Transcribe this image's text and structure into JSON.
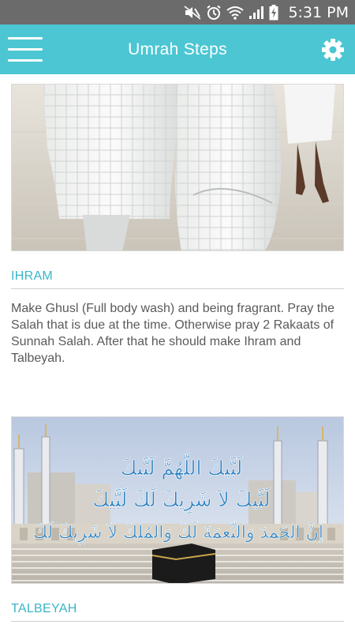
{
  "status_bar": {
    "time": "5:31 PM",
    "icons": [
      "mute-icon",
      "alarm-icon",
      "wifi-icon",
      "signal-icon",
      "battery-charging-icon"
    ]
  },
  "app_bar": {
    "title": "Umrah Steps",
    "menu_icon": "hamburger-menu-icon",
    "settings_icon": "gear-icon",
    "background_color": "#4cc6d3"
  },
  "steps": [
    {
      "title": "IHRAM",
      "description": "Make Ghusl (Full body wash) and being fragrant. Pray the Salah that is due at the time. Otherwise pray 2 Rakaats of Sunnah Salah. After that he should make Ihram and Talbeyah.",
      "image": "pilgrims-in-ihram-photo"
    },
    {
      "title": "TALBEYAH",
      "image": "talbeyah-kaaba-photo",
      "image_text": {
        "line1": "لَبَّيكَ اللّهُمَّ لَبَّيكَ",
        "line2": "لَبَّيكَ لاَ شَرِيكَ لَكَ لَبَّيكَ",
        "line3": "إنَّ الحَمدَ وَالنِّعمَةَ لَكَ وَالمُلكَ لاَ شَرِيكَ لَكَ"
      }
    }
  ],
  "colors": {
    "accent": "#39b6c7",
    "status_bar": "#6b6b6b",
    "body_text": "#5a5a5a"
  }
}
